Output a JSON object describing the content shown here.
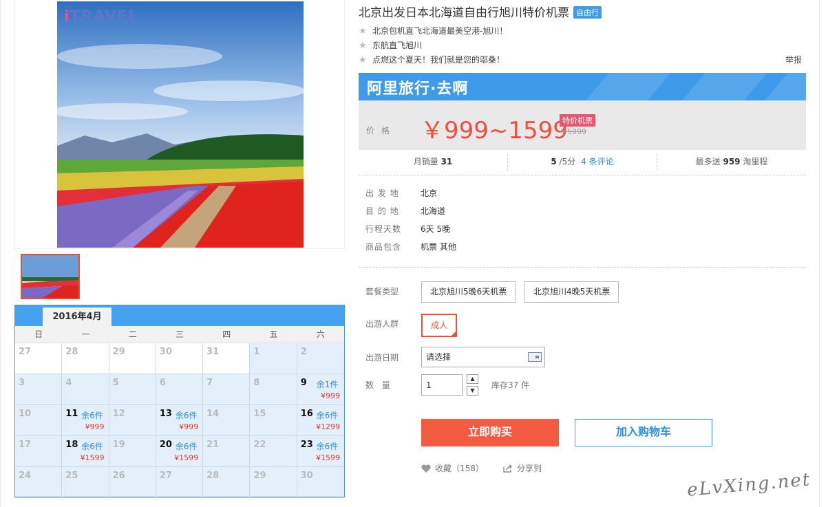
{
  "product": {
    "title": "北京出发日本北海道自由行旭川特价机票",
    "tag": "自由行",
    "bullets": [
      "北京包机直飞北海道最美空港-旭川！",
      "东航直飞旭川",
      "点燃这个夏天！我们就是您的邬桑！"
    ],
    "report": "举报",
    "logo": "TRAVEL"
  },
  "price": {
    "banner": "阿里旅行·去啊",
    "label": "价格",
    "value": "￥999~1599",
    "badge": "特价机票",
    "original": "￥5999"
  },
  "stats": {
    "sales_label": "月销量",
    "sales": "31",
    "rating": "5",
    "rating_suffix": "/5分",
    "reviews": "4 条评论",
    "points_prefix": "最多送",
    "points": "959",
    "points_suffix": "淘里程"
  },
  "info": [
    {
      "k": "出 发 地",
      "v": "北京"
    },
    {
      "k": "目 的 地",
      "v": "北海道"
    },
    {
      "k": "行程天数",
      "v": "6天 5晚"
    },
    {
      "k": "商品包含",
      "v": "机票  其他"
    }
  ],
  "options": {
    "package_label": "套餐类型",
    "packages": [
      "北京旭川5晚6天机票",
      "北京旭川4晚5天机票"
    ],
    "pax_label": "出游人群",
    "pax_selected": "成人",
    "date_label": "出游日期",
    "date_value": "请选择",
    "qty_label": "数    量",
    "qty_value": "1",
    "stock": "库存37 件"
  },
  "actions": {
    "buy": "立即购买",
    "cart": "加入购物车",
    "fav": "收藏（158）",
    "share": "分享到"
  },
  "calendar": {
    "month": "2016年4月",
    "weekdays": [
      "日",
      "一",
      "二",
      "三",
      "四",
      "五",
      "六"
    ],
    "cells": [
      {
        "d": "27",
        "prev": true
      },
      {
        "d": "28",
        "prev": true
      },
      {
        "d": "29",
        "prev": true
      },
      {
        "d": "30",
        "prev": true
      },
      {
        "d": "31",
        "prev": true
      },
      {
        "d": "1"
      },
      {
        "d": "2"
      },
      {
        "d": "3"
      },
      {
        "d": "4"
      },
      {
        "d": "5"
      },
      {
        "d": "6"
      },
      {
        "d": "7"
      },
      {
        "d": "8"
      },
      {
        "d": "9",
        "stock": "余1件",
        "price": "¥999"
      },
      {
        "d": "10"
      },
      {
        "d": "11",
        "stock": "余6件",
        "price": "¥999"
      },
      {
        "d": "12"
      },
      {
        "d": "13",
        "stock": "余6件",
        "price": "¥999"
      },
      {
        "d": "14"
      },
      {
        "d": "15"
      },
      {
        "d": "16",
        "stock": "余6件",
        "price": "¥1299"
      },
      {
        "d": "17"
      },
      {
        "d": "18",
        "stock": "余6件",
        "price": "¥1599"
      },
      {
        "d": "19"
      },
      {
        "d": "20",
        "stock": "余6件",
        "price": "¥1599"
      },
      {
        "d": "21"
      },
      {
        "d": "22"
      },
      {
        "d": "23",
        "stock": "余6件",
        "price": "¥1599"
      },
      {
        "d": "24"
      },
      {
        "d": "25"
      },
      {
        "d": "26"
      },
      {
        "d": "27"
      },
      {
        "d": "28"
      },
      {
        "d": "29"
      },
      {
        "d": "30"
      }
    ]
  },
  "watermark": "eLvXing.net",
  "colors": {
    "accent": "#3d9be9",
    "price": "#f24d3a",
    "buy": "#f55b40"
  }
}
